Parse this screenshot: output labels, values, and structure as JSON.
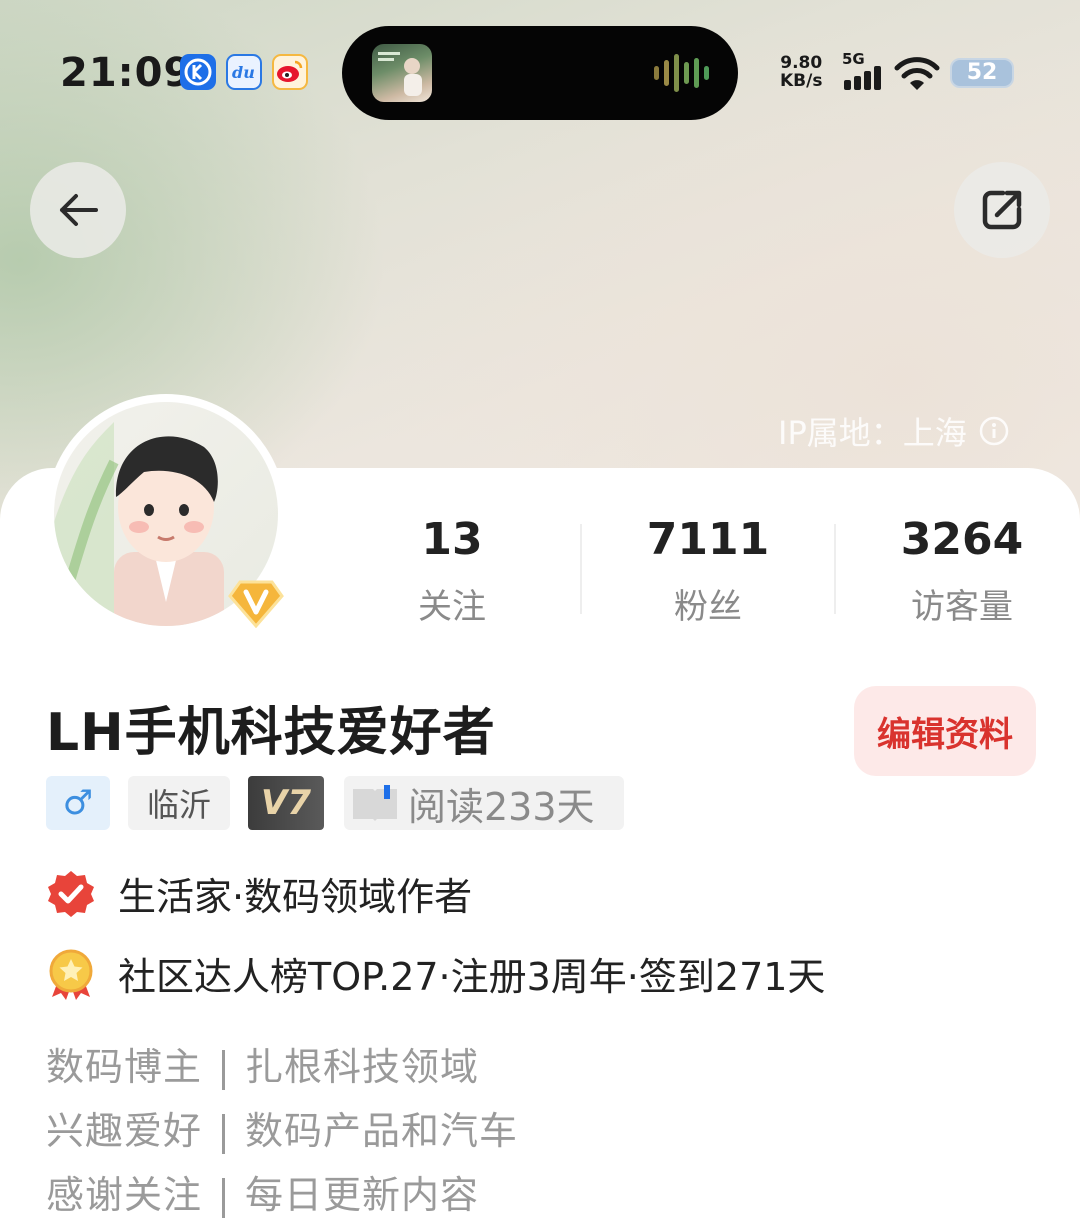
{
  "status_bar": {
    "time": "21:09",
    "net_speed_value": "9.80",
    "net_speed_unit": "KB/s",
    "network_type": "5G",
    "battery": "52",
    "app_icons": [
      "kugou-icon",
      "du-icon",
      "weibo-icon"
    ]
  },
  "header": {
    "back_icon": "arrow-left-icon",
    "share_icon": "share-export-icon",
    "ip_location": "IP属地：上海"
  },
  "stats": [
    {
      "value": "13",
      "label": "关注"
    },
    {
      "value": "7111",
      "label": "粉丝"
    },
    {
      "value": "3264",
      "label": "访客量"
    }
  ],
  "profile": {
    "username": "LH手机科技爱好者",
    "edit_label": "编辑资料",
    "gender_symbol": "♂",
    "city": "临沂",
    "level": "V7",
    "reading": "阅读233天",
    "verified": "生活家·数码领域作者",
    "achievement": "社区达人榜TOP.27·注册3周年·签到271天"
  },
  "bio": [
    {
      "left": "数码博主",
      "right": "扎根科技领域"
    },
    {
      "left": "兴趣爱好",
      "right": "数码产品和汽车"
    },
    {
      "left": "感谢关注",
      "right": "每日更新内容"
    }
  ],
  "colors": {
    "accent_red": "#d9332e",
    "edit_bg": "#fde9e8",
    "gender_blue": "#3d8fe0"
  }
}
